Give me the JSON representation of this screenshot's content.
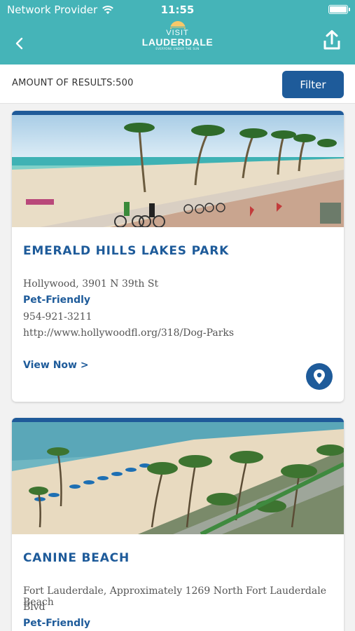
{
  "status_bar": {
    "carrier": "Network Provider",
    "time": "11:55"
  },
  "header": {
    "logo": {
      "line1": "VISIT",
      "line2": "LAUDERDALE",
      "tagline": "EVERYONE UNDER THE SUN"
    },
    "colors": {
      "bar": "#45b4b8",
      "accent": "#1e5b9a"
    }
  },
  "results": {
    "count_label": "AMOUNT OF RESULTS:500",
    "filter_label": "Filter"
  },
  "listings": [
    {
      "title": "EMERALD HILLS LAKES PARK",
      "address": "Hollywood, 3901 N 39th St",
      "tag": "Pet-Friendly",
      "phone": "954-921-3211",
      "url": "http://www.hollywoodfl.org/318/Dog-Parks",
      "link_label": "View Now >",
      "image": "beach-boardwalk-cyclists-photo"
    },
    {
      "title": "CANINE BEACH",
      "address_line1": "Fort Lauderdale, Approximately 1269 North Fort Lauderdale Beach",
      "address_line2": "Blvd",
      "tag": "Pet-Friendly",
      "image": "aerial-beach-palms-photo"
    }
  ]
}
